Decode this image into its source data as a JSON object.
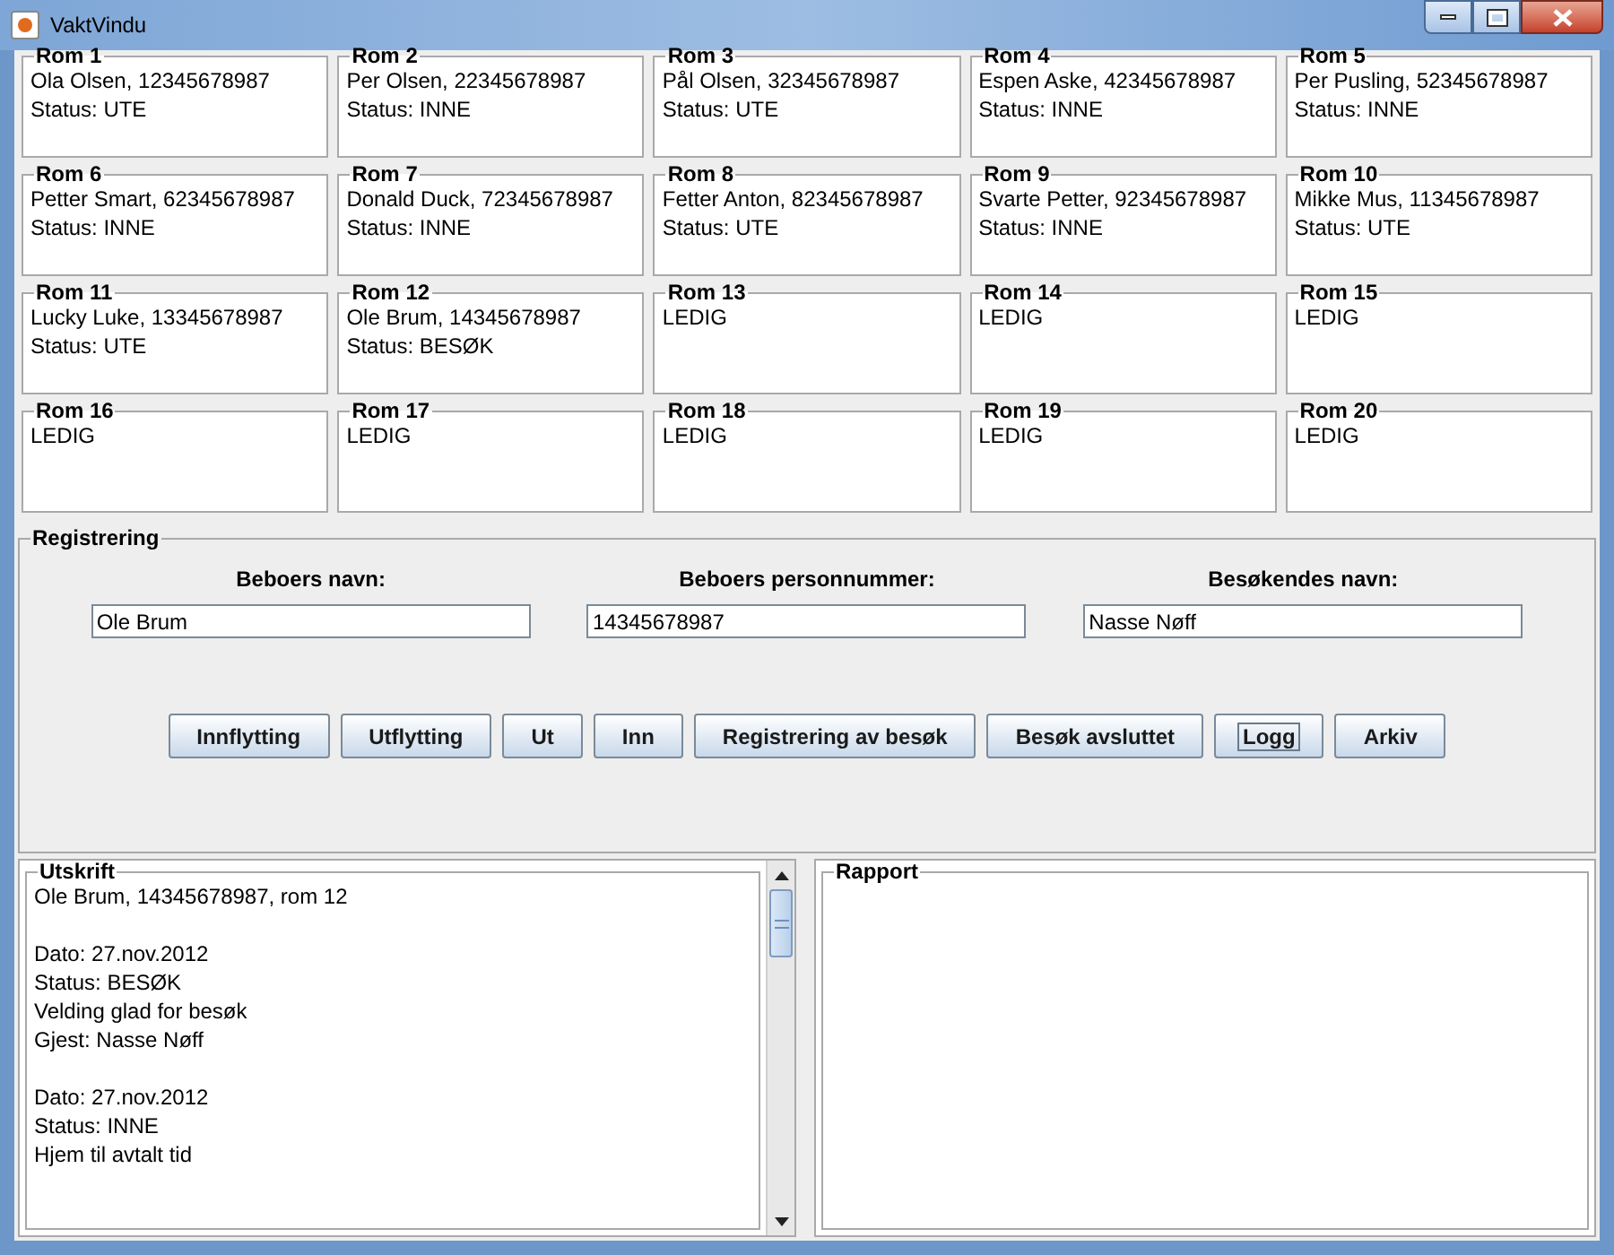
{
  "window": {
    "title": "VaktVindu"
  },
  "rooms": [
    {
      "title": "Rom 1",
      "lines": [
        "Ola Olsen, 12345678987",
        "Status: UTE"
      ]
    },
    {
      "title": "Rom 2",
      "lines": [
        "Per Olsen, 22345678987",
        "Status: INNE"
      ]
    },
    {
      "title": "Rom 3",
      "lines": [
        "Pål Olsen, 32345678987",
        "Status: UTE"
      ]
    },
    {
      "title": "Rom 4",
      "lines": [
        "Espen Aske, 42345678987",
        "Status: INNE"
      ]
    },
    {
      "title": "Rom 5",
      "lines": [
        "Per Pusling, 52345678987",
        "Status: INNE"
      ]
    },
    {
      "title": "Rom 6",
      "lines": [
        "Petter Smart, 62345678987",
        "Status: INNE"
      ]
    },
    {
      "title": "Rom 7",
      "lines": [
        "Donald Duck, 72345678987",
        "Status: INNE"
      ]
    },
    {
      "title": "Rom 8",
      "lines": [
        "Fetter Anton, 82345678987",
        "Status: UTE"
      ]
    },
    {
      "title": "Rom 9",
      "lines": [
        "Svarte Petter, 92345678987",
        "Status: INNE"
      ]
    },
    {
      "title": "Rom 10",
      "lines": [
        "Mikke Mus, 11345678987",
        "Status: UTE"
      ]
    },
    {
      "title": "Rom 11",
      "lines": [
        "Lucky Luke, 13345678987",
        "Status: UTE"
      ]
    },
    {
      "title": "Rom 12",
      "lines": [
        "Ole Brum, 14345678987",
        "Status: BESØK"
      ]
    },
    {
      "title": "Rom 13",
      "lines": [
        "LEDIG"
      ]
    },
    {
      "title": "Rom 14",
      "lines": [
        "LEDIG"
      ]
    },
    {
      "title": "Rom 15",
      "lines": [
        "LEDIG"
      ]
    },
    {
      "title": "Rom 16",
      "lines": [
        "LEDIG"
      ]
    },
    {
      "title": "Rom 17",
      "lines": [
        "LEDIG"
      ]
    },
    {
      "title": "Rom 18",
      "lines": [
        "LEDIG"
      ]
    },
    {
      "title": "Rom 19",
      "lines": [
        "LEDIG"
      ]
    },
    {
      "title": "Rom 20",
      "lines": [
        "LEDIG"
      ]
    }
  ],
  "registration": {
    "title": "Registrering",
    "fields": [
      {
        "label": "Beboers navn:",
        "value": "Ole Brum"
      },
      {
        "label": "Beboers personnummer:",
        "value": "14345678987"
      },
      {
        "label": "Besøkendes navn:",
        "value": "Nasse Nøff"
      }
    ],
    "buttons": [
      {
        "label": "Innflytting",
        "focused": false
      },
      {
        "label": "Utflytting",
        "focused": false
      },
      {
        "label": "Ut",
        "focused": false
      },
      {
        "label": "Inn",
        "focused": false
      },
      {
        "label": "Registrering av besøk",
        "focused": false
      },
      {
        "label": "Besøk avsluttet",
        "focused": false
      },
      {
        "label": "Logg",
        "focused": true
      },
      {
        "label": "Arkiv",
        "focused": false
      }
    ]
  },
  "output": {
    "title": "Utskrift",
    "paragraphs": [
      [
        "Ole Brum, 14345678987, rom 12"
      ],
      [
        "Dato: 27.nov.2012",
        "Status: BESØK",
        "Velding glad for besøk",
        "Gjest: Nasse Nøff"
      ],
      [
        "Dato: 27.nov.2012",
        "Status: INNE",
        "Hjem til avtalt tid"
      ]
    ]
  },
  "report": {
    "title": "Rapport"
  }
}
